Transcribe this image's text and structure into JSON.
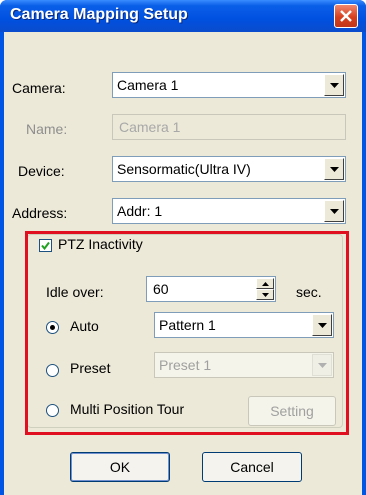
{
  "window": {
    "title": "Camera Mapping Setup"
  },
  "camera": {
    "label": "Camera:",
    "value": "Camera 1"
  },
  "name": {
    "label": "Name:",
    "value": "Camera 1"
  },
  "device": {
    "label": "Device:",
    "value": "Sensormatic(Ultra IV)"
  },
  "address": {
    "label": "Address:",
    "value": "Addr: 1"
  },
  "ptz": {
    "checkbox_label": "PTZ Inactivity",
    "checked": true,
    "idle_label": "Idle over:",
    "idle_value": "60",
    "idle_unit": "sec.",
    "auto_label": "Auto",
    "auto_selected": true,
    "auto_value": "Pattern 1",
    "preset_label": "Preset",
    "preset_value": "Preset 1",
    "tour_label": "Multi Position Tour",
    "setting_label": "Setting"
  },
  "buttons": {
    "ok": "OK",
    "cancel": "Cancel"
  },
  "colors": {
    "highlight": "#e01020",
    "titlebar": "#0050e0",
    "dialog_bg": "#ece9d8"
  }
}
